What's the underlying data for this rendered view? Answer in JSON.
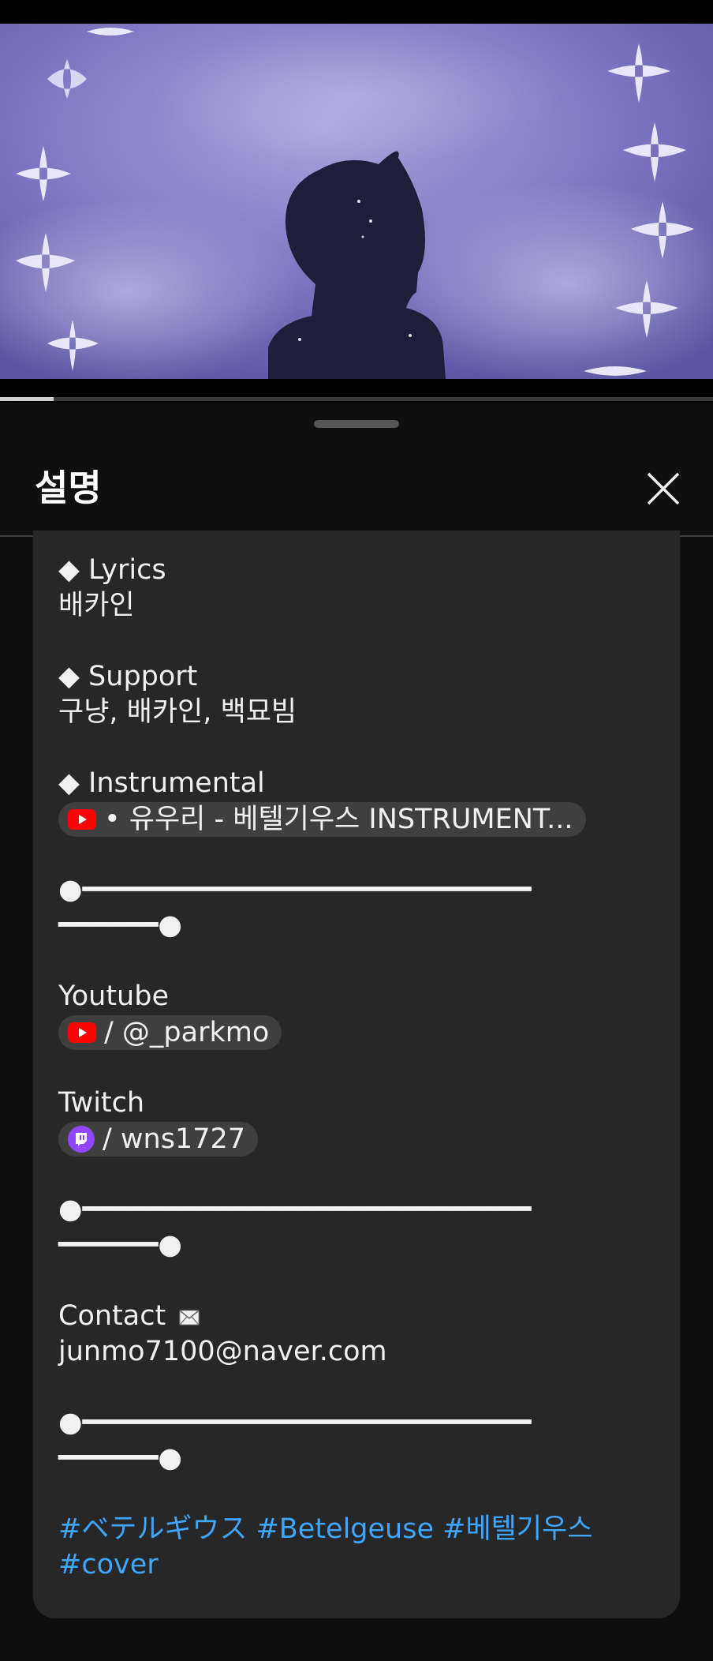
{
  "sheet": {
    "title": "설명"
  },
  "video": {
    "progress": 0.075,
    "accent_color": "#cfcfcf"
  },
  "description": {
    "lyrics_heading": "◆ Lyrics",
    "lyrics_value": "배카인",
    "support_heading": "◆ Support",
    "support_value": "구냥, 배카인, 백묘빔",
    "instrumental_heading": "◆ Instrumental",
    "instrumental_link": "• 유우리 - 베텔기우스 INSTRUMENT...",
    "separator_line1": "●━━━━━━━━━━━━━━━━━━━━━━━━━━━",
    "separator_line2": "━━━━━━●",
    "youtube_heading": "Youtube",
    "youtube_link": "/ @_parkmo",
    "twitch_heading": "Twitch",
    "twitch_link": "/ wns1727",
    "contact_heading": "Contact",
    "contact_email": "junmo7100@naver.com",
    "hashtags_line1": "#ベテルギウス #Betelgeuse #베텔기우스",
    "hashtags_line2": "#cover",
    "icons": {
      "youtube": "youtube-icon",
      "twitch": "twitch-icon",
      "envelope": "envelope-icon",
      "close": "close-icon"
    },
    "colors": {
      "link": "#3ea6ff",
      "youtube_red": "#ff0000",
      "twitch_purple": "#9146ff"
    }
  }
}
